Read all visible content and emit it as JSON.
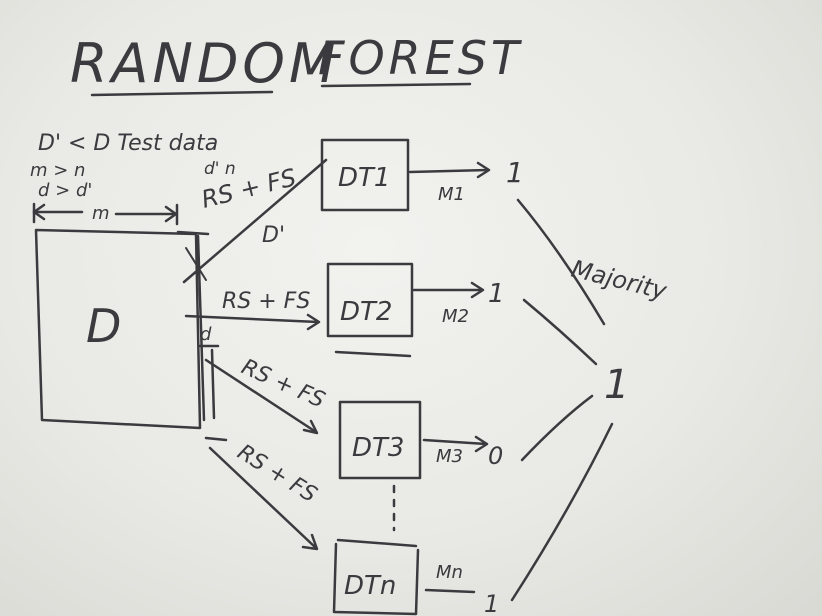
{
  "whiteboard": {
    "title_word1": "RANDOM",
    "title_word2": "FOREST",
    "notes": {
      "line1": "D' < D  Test data",
      "line2": "m > n",
      "line3": "d > d'"
    },
    "dataset": {
      "label": "D",
      "width_label": "m",
      "small_d": "d"
    },
    "branches": [
      {
        "edge_label": "RS + FS",
        "top_labels": "d'  n",
        "sample_label": "D'",
        "tree": "DT1",
        "model": "M1",
        "output": "1"
      },
      {
        "edge_label": "RS + FS",
        "tree": "DT2",
        "model": "M2",
        "output": "1"
      },
      {
        "edge_label": "RS + FS",
        "tree": "DT3",
        "model": "M3",
        "output": "0"
      },
      {
        "edge_label": "RS + FS",
        "tree": "DTn",
        "model": "Mn",
        "output": "1"
      }
    ],
    "aggregation": {
      "label": "Majority",
      "result": "1"
    }
  }
}
